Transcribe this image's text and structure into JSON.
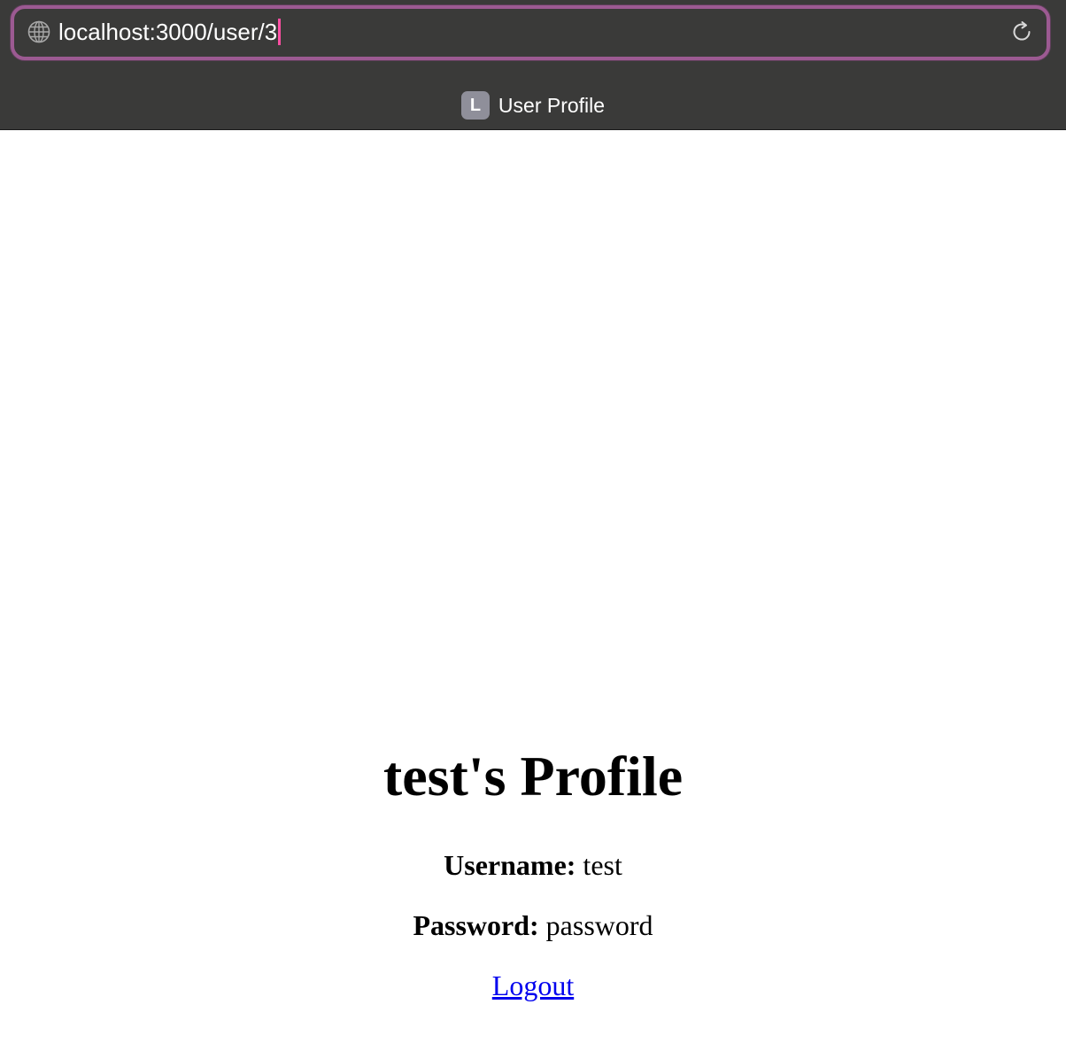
{
  "browser": {
    "url": "localhost:3000/user/3",
    "tab": {
      "favicon_letter": "L",
      "title": "User Profile"
    },
    "icons": {
      "globe": "globe-icon",
      "reload": "reload-icon"
    }
  },
  "page": {
    "heading": "test's Profile",
    "username_label": "Username:",
    "username_value": "test",
    "password_label": "Password:",
    "password_value": "password",
    "logout_label": "Logout"
  },
  "colors": {
    "chrome_background": "#3a3a39",
    "address_bar_focus_ring": "#9c5a92",
    "caret": "#ff4fa3",
    "favicon_background": "#8f8f9a",
    "link": "#0000ee"
  }
}
